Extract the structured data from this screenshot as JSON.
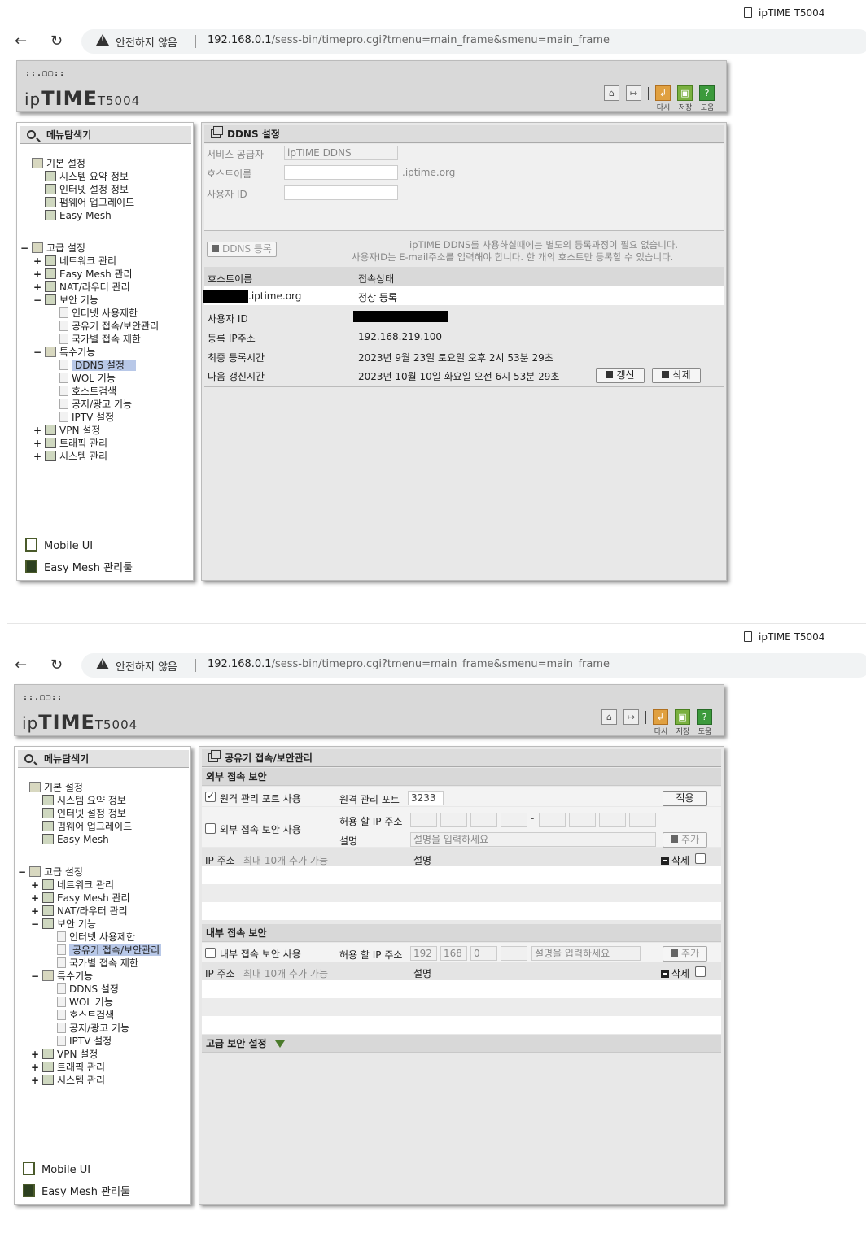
{
  "browser": {
    "tab_title": "ipTIME T5004",
    "security_label": "안전하지 않음",
    "url_host": "192.168.0.1",
    "url_path": "/sess-bin/timepro.cgi?tmenu=main_frame&smenu=main_frame"
  },
  "router": {
    "logo_dots": "::.▢▢::",
    "logo_ip": "ip",
    "logo_time": "TIME",
    "logo_model": "T5004",
    "header_buttons": {
      "reload": "다시",
      "save": "저장",
      "help": "도움"
    }
  },
  "sidebar": {
    "title": "메뉴탐색기",
    "basic": {
      "label": "기본 설정",
      "items": [
        "시스템 요약 정보",
        "인터넷 설정 정보",
        "펌웨어 업그레이드",
        "Easy Mesh"
      ]
    },
    "advanced": {
      "label": "고급 설정",
      "items": [
        "네트워크 관리",
        "Easy Mesh 관리",
        "NAT/라우터 관리",
        "보안 기능"
      ],
      "security_items": [
        "인터넷 사용제한",
        "공유기 접속/보안관리",
        "국가별 접속 제한"
      ],
      "special_label": "특수기능",
      "special_items": [
        "DDNS 설정",
        "WOL 기능",
        "호스트검색",
        "공지/광고 기능",
        "IPTV 설정"
      ],
      "more_items": [
        "VPN 설정",
        "트래픽 관리",
        "시스템 관리"
      ]
    },
    "mobile_ui": "Mobile UI",
    "easymesh_tool": "Easy Mesh 관리툴"
  },
  "ddns": {
    "title": "DDNS 설정",
    "provider_label": "서비스 공급자",
    "provider_value": "ipTIME DDNS",
    "host_label": "호스트이름",
    "host_value": "",
    "host_suffix": ".iptime.org",
    "user_label": "사용자 ID",
    "user_value": "",
    "register_btn": "DDNS 등록",
    "notice1": "ipTIME DDNS를 사용하실때에는 별도의 등록과정이 필요 없습니다.",
    "notice2": "사용자ID는 E-mail주소를 입력해야 합니다. 한 개의 호스트만 등록할 수 있습니다.",
    "col_host": "호스트이름",
    "col_status": "접속상태",
    "row_host_suffix": ".iptime.org",
    "row_status": "정상 등록",
    "detail": {
      "user_label": "사용자 ID",
      "ip_label": "등록 IP주소",
      "ip_value": "192.168.219.100",
      "last_label": "최종 등록시간",
      "last_value": "2023년 9월 23일 토요일 오후 2시 53분 29초",
      "next_label": "다음 갱신시간",
      "next_value": "2023년 10월 10일 화요일 오전 6시 53분 29초"
    },
    "renew_btn": "갱신",
    "delete_btn": "삭제"
  },
  "security": {
    "title": "공유기 접속/보안관리",
    "external_title": "외부 접속 보안",
    "remote_port_checkbox": "원격 관리 포트 사용",
    "remote_port_checked": true,
    "remote_port_label": "원격 관리 포트",
    "remote_port_value": "3233",
    "apply_btn": "적용",
    "ext_security_checkbox": "외부 접속 보안 사용",
    "ext_security_checked": false,
    "allow_ip_label": "허용 할 IP 주소",
    "desc_label": "설명",
    "desc_placeholder": "설명을 입력하세요",
    "add_btn": "추가",
    "list_ip_header": "IP 주소",
    "list_limit": "최대 10개 추가 가능",
    "list_desc_header": "설명",
    "list_delete": "삭제",
    "internal_title": "내부 접속 보안",
    "int_security_checkbox": "내부 접속 보안 사용",
    "int_security_checked": false,
    "int_ip": [
      "192",
      "168",
      "0",
      ""
    ],
    "advanced_title": "고급 보안 설정"
  }
}
